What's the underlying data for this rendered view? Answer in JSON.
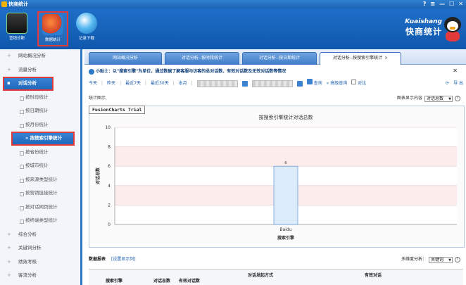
{
  "window": {
    "title": "快商统计",
    "controls": [
      "?",
      "≡",
      "—",
      "☐",
      "✕"
    ]
  },
  "toolbar": {
    "tools": [
      {
        "label": "营销诊断"
      },
      {
        "label": "数据统计"
      },
      {
        "label": "记录下载"
      }
    ]
  },
  "brand": {
    "line1": "Kuaishang",
    "line2": "快商统计"
  },
  "sidebar": {
    "items": [
      {
        "label": "网站概况分析"
      },
      {
        "label": "流量分析"
      }
    ],
    "active_group": {
      "label": "对话分析"
    },
    "subitems": [
      {
        "label": "按时段统计"
      },
      {
        "label": "按日期统计"
      },
      {
        "label": "按月份统计"
      },
      {
        "label": "按搜索引擎统计",
        "current": true
      },
      {
        "label": "按省份统计"
      },
      {
        "label": "按城市统计"
      },
      {
        "label": "按来源类型统计"
      },
      {
        "label": "按营销链接统计"
      },
      {
        "label": "按对话网页统计"
      },
      {
        "label": "按终端类型统计"
      }
    ],
    "more_items": [
      {
        "label": "综合分析"
      },
      {
        "label": "关键词分析"
      },
      {
        "label": "绩效考核"
      },
      {
        "label": "客流分析"
      }
    ]
  },
  "tabs": [
    {
      "label": "网站概况分析"
    },
    {
      "label": "对话分析--按时段统计"
    },
    {
      "label": "对话分析--按日期统计"
    },
    {
      "label": "对话分析--按搜索引擎统计",
      "active": true
    }
  ],
  "tip": {
    "text": "小贴士：以\"搜索引擎\"为单位，通过数据了解客服与访客的总对话数、有效对话数及无效对话数等情况"
  },
  "filters": {
    "today": "今天",
    "yesterday": "昨天",
    "last7": "最近7天",
    "last30": "最近30天",
    "month": "本月",
    "query": "查询",
    "advanced": "高级查询",
    "compare": "对比",
    "export": "导 出",
    "refresh_icon": "refresh-icon"
  },
  "chart_section": {
    "title": "统计图示",
    "content_label": "图表显示内容",
    "content_value": "对话总数"
  },
  "chart_data": {
    "type": "bar",
    "title": "按搜索引擎统计对话总数",
    "categories": [
      "Baidu"
    ],
    "values": [
      6
    ],
    "data_labels": [
      "6"
    ],
    "xlabel": "搜索引擎",
    "ylabel": "对话总数",
    "ylim": [
      0,
      10
    ],
    "yticks": [
      0,
      2,
      4,
      6,
      8,
      10
    ],
    "watermark": "FusionCharts Trial",
    "colors": {
      "bar": "#dcebfa",
      "bar_stroke": "#6a9fd6",
      "band": "#fcecec"
    }
  },
  "report": {
    "title": "数据报表",
    "settings_link": "[设置显示列]",
    "dimension_label": "多维度分析：",
    "dimension_value": "关键词",
    "columns": [
      "搜索引擎",
      "对话总数",
      "有效对话数",
      "对话发起方式",
      "有效对话"
    ]
  }
}
